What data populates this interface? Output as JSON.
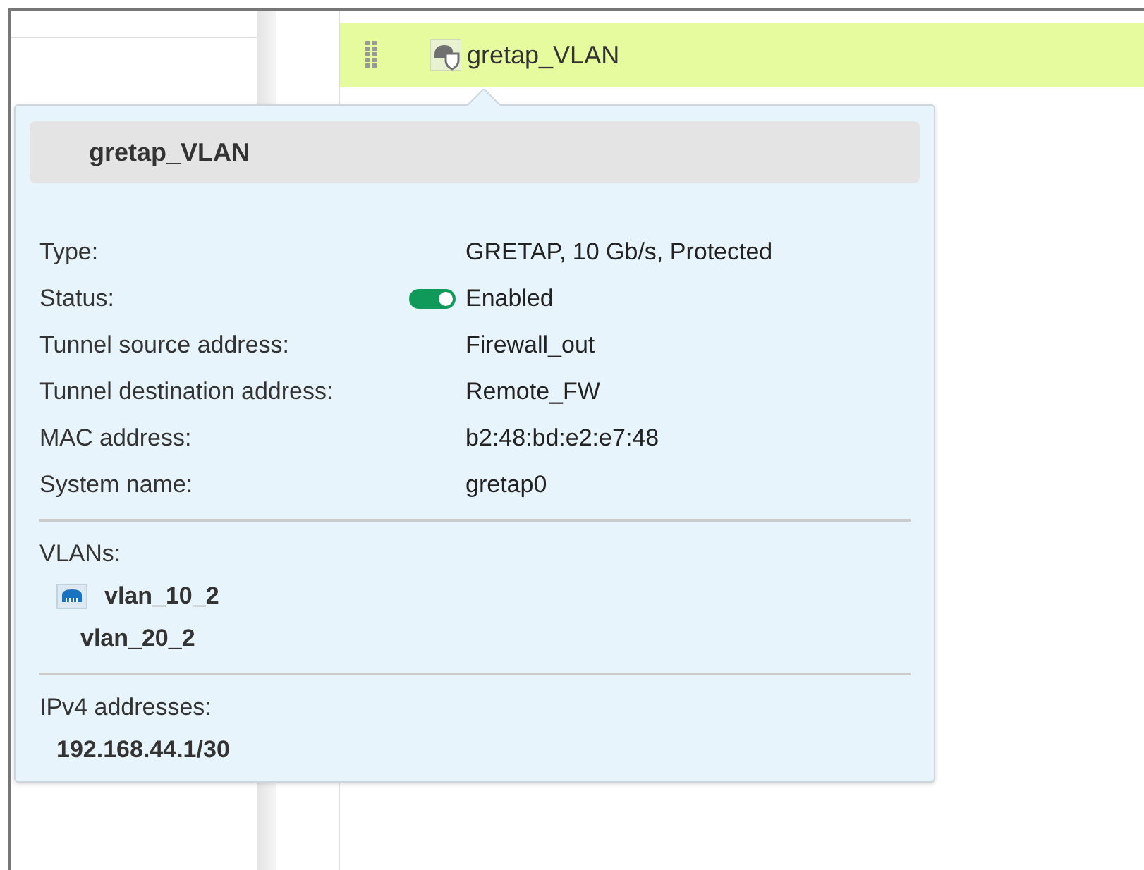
{
  "row": {
    "label": "gretap_VLAN",
    "selected": true
  },
  "tooltip": {
    "title": "gretap_VLAN",
    "properties": [
      {
        "label": "Type:",
        "value": "GRETAP, 10 Gb/s, Protected",
        "kind": "text"
      },
      {
        "label": "Status:",
        "value": "Enabled",
        "kind": "toggle",
        "on": true
      },
      {
        "label": "Tunnel source address:",
        "value": "Firewall_out",
        "kind": "text"
      },
      {
        "label": "Tunnel destination address:",
        "value": "Remote_FW",
        "kind": "text"
      },
      {
        "label": "MAC address:",
        "value": "b2:48:bd:e2:e7:48",
        "kind": "text"
      },
      {
        "label": "System name:",
        "value": "gretap0",
        "kind": "text"
      }
    ],
    "vlans": {
      "label": "VLANs:",
      "items": [
        {
          "name": "vlan_10_2",
          "has_icon": true
        },
        {
          "name": "vlan_20_2",
          "has_icon": false
        }
      ]
    },
    "ipv4": {
      "label": "IPv4 addresses:",
      "items": [
        "192.168.44.1/30"
      ]
    }
  }
}
